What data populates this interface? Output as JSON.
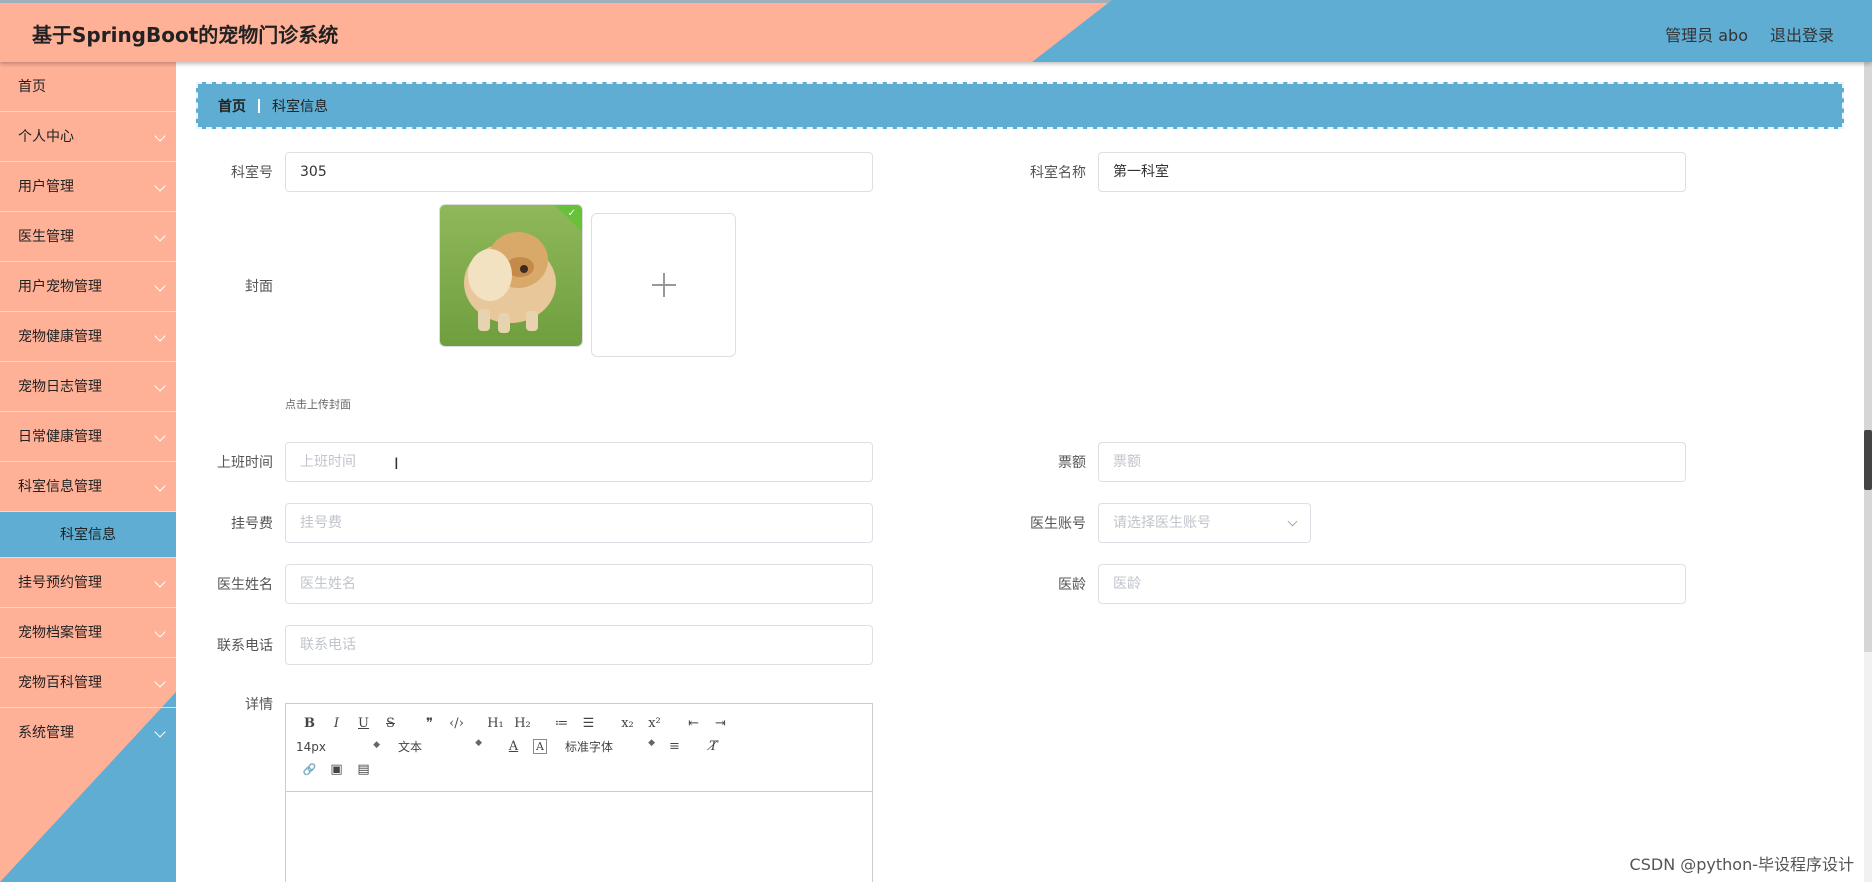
{
  "header": {
    "title": "基于SpringBoot的宠物门诊系统",
    "admin": "管理员 abo",
    "logout": "退出登录"
  },
  "sidebar": {
    "items": [
      {
        "label": "首页",
        "chevron": false
      },
      {
        "label": "个人中心",
        "chevron": true
      },
      {
        "label": "用户管理",
        "chevron": true
      },
      {
        "label": "医生管理",
        "chevron": true
      },
      {
        "label": "用户宠物管理",
        "chevron": true
      },
      {
        "label": "宠物健康管理",
        "chevron": true
      },
      {
        "label": "宠物日志管理",
        "chevron": true
      },
      {
        "label": "日常健康管理",
        "chevron": true
      },
      {
        "label": "科室信息管理",
        "chevron": true
      },
      {
        "label": "科室信息",
        "sub": true
      },
      {
        "label": "挂号预约管理",
        "chevron": true
      },
      {
        "label": "宠物档案管理",
        "chevron": true
      },
      {
        "label": "宠物百科管理",
        "chevron": true
      },
      {
        "label": "系统管理",
        "chevron": true
      }
    ]
  },
  "breadcrumb": {
    "home": "首页",
    "current": "科室信息"
  },
  "form": {
    "room_no_label": "科室号",
    "room_no_value": "305",
    "room_name_label": "科室名称",
    "room_name_value": "第一科室",
    "cover_label": "封面",
    "cover_tip": "点击上传封面",
    "work_time_label": "上班时间",
    "work_time_placeholder": "上班时间",
    "tickets_label": "票额",
    "tickets_placeholder": "票额",
    "fee_label": "挂号费",
    "fee_placeholder": "挂号费",
    "doctor_account_label": "医生账号",
    "doctor_account_placeholder": "请选择医生账号",
    "doctor_name_label": "医生姓名",
    "doctor_name_placeholder": "医生姓名",
    "doctor_age_label": "医龄",
    "doctor_age_placeholder": "医龄",
    "phone_label": "联系电话",
    "phone_placeholder": "联系电话",
    "details_label": "详情"
  },
  "editor": {
    "font_size": "14px",
    "header_select": "文本",
    "font_family": "标准字体",
    "buttons": {
      "bold": "B",
      "italic": "I",
      "underline": "U",
      "strike": "S",
      "quote": "❞",
      "code": "‹/›",
      "h1": "H₁",
      "h2": "H₂",
      "ol": "≔",
      "ul": "☰",
      "sub": "x₂",
      "sup": "x²",
      "outdent": "⇤",
      "indent": "⇥",
      "color": "A",
      "bg": "A",
      "align": "≡",
      "clean": "T̸",
      "link": "🔗",
      "image": "▣",
      "video": "▤"
    }
  },
  "watermark": "CSDN @python-毕设程序设计",
  "colors": {
    "salmon": "#ffb198",
    "blue": "#5fadd3"
  }
}
